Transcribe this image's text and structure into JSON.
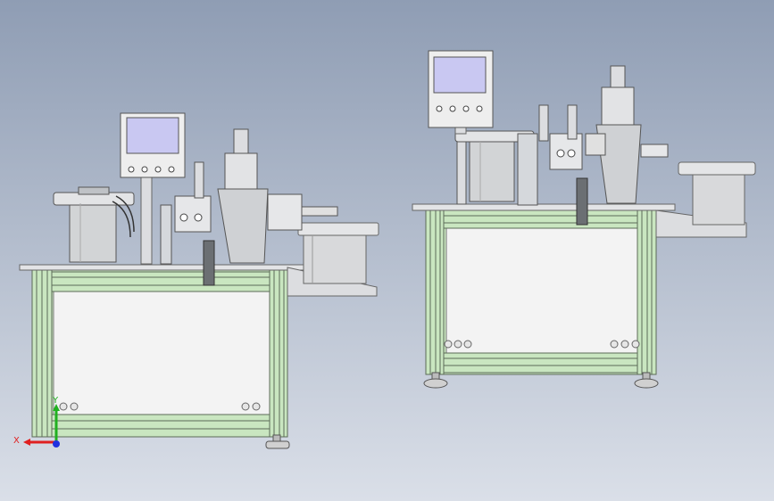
{
  "viewport": {
    "background_top": "#8f9db4",
    "background_bottom": "#dadfe8"
  },
  "colors": {
    "frame_green": "#c9e6c0",
    "frame_edge": "#5c6b57",
    "panel": "#f2f2f2",
    "metal": "#d5d8dc",
    "metal_dark": "#9aa0a6",
    "screen": "#c9c8f2",
    "hopper": "#d2d4d6"
  },
  "machines": [
    {
      "name": "machine-front-view",
      "icons": [
        "hmi-screen",
        "vibratory-bowl",
        "press-cylinder",
        "storage-bin",
        "leveling-foot"
      ]
    },
    {
      "name": "machine-iso-view",
      "icons": [
        "hmi-screen",
        "vibratory-bowl",
        "press-cylinder",
        "storage-bin",
        "leveling-foot"
      ]
    }
  ],
  "triad": {
    "x_label": "X",
    "y_label": "Y",
    "x_color": "#e02020",
    "y_color": "#20b020",
    "z_color": "#2030e0"
  }
}
